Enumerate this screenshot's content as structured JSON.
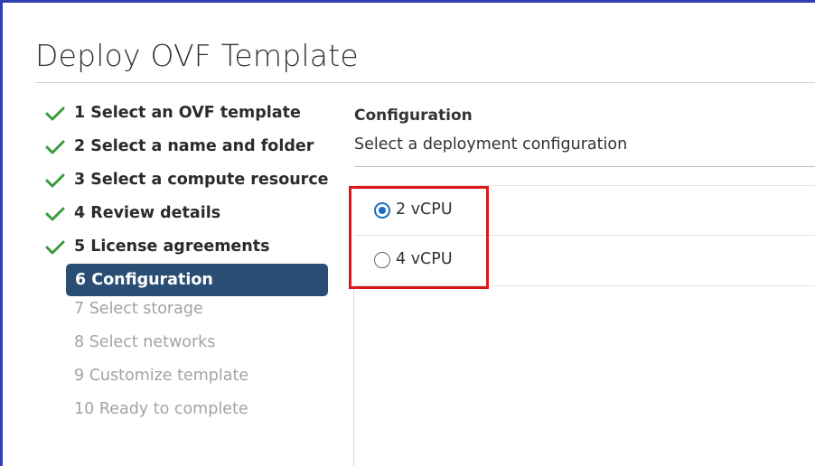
{
  "window": {
    "title": "Deploy OVF Template"
  },
  "steps": [
    {
      "label": "1 Select an OVF template",
      "status": "done"
    },
    {
      "label": "2 Select a name and folder",
      "status": "done"
    },
    {
      "label": "3 Select a compute resource",
      "status": "done"
    },
    {
      "label": "4 Review details",
      "status": "done"
    },
    {
      "label": "5 License agreements",
      "status": "done"
    },
    {
      "label": "6 Configuration",
      "status": "active"
    },
    {
      "label": "7 Select storage",
      "status": "todo"
    },
    {
      "label": "8 Select networks",
      "status": "todo"
    },
    {
      "label": "9 Customize template",
      "status": "todo"
    },
    {
      "label": "10 Ready to complete",
      "status": "todo"
    }
  ],
  "main": {
    "heading": "Configuration",
    "subheading": "Select a deployment configuration",
    "options": [
      {
        "label": "2 vCPU",
        "selected": true
      },
      {
        "label": "4 vCPU",
        "selected": false
      }
    ]
  },
  "colors": {
    "frame": "#2f3fb0",
    "check": "#3c9a3c",
    "active_step_bg": "#2a4e73",
    "radio_selected": "#1b6fc2",
    "highlight_box": "#d7191c"
  },
  "icons": {
    "completed_step": "check-icon",
    "option": "radio-icon"
  }
}
